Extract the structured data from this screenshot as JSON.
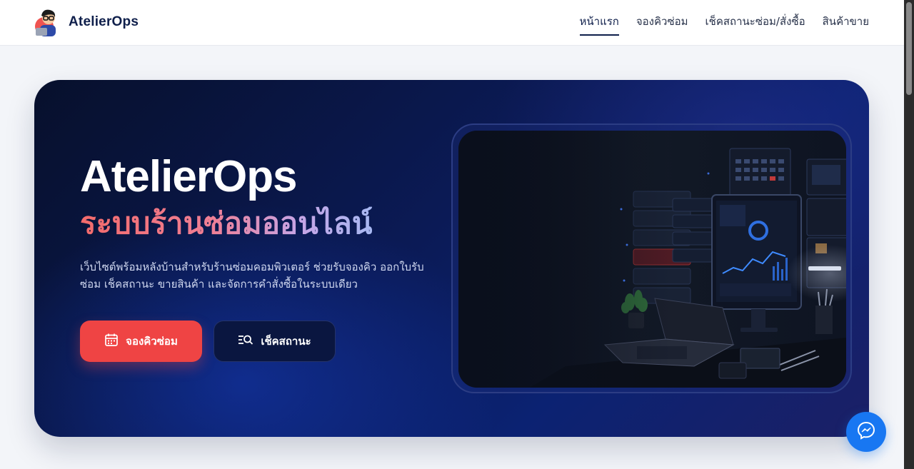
{
  "header": {
    "brand": "AtelierOps",
    "nav": [
      {
        "label": "หน้าแรก",
        "active": true
      },
      {
        "label": "จองคิวซ่อม",
        "active": false
      },
      {
        "label": "เช็คสถานะซ่อม/สั่งซื้อ",
        "active": false
      },
      {
        "label": "สินค้าขาย",
        "active": false
      }
    ]
  },
  "hero": {
    "title": "AtelierOps",
    "subtitle": "ระบบร้านซ่อมออนไลน์",
    "description": "เว็บไซต์พร้อมหลังบ้านสำหรับร้านซ่อมคอมพิวเตอร์ ช่วยรับจองคิว ออกใบรับซ่อม เช็คสถานะ ขายสินค้า และจัดการคำสั่งซื้อในระบบเดียว",
    "primary_button": "จองคิวซ่อม",
    "secondary_button": "เช็คสถานะ"
  },
  "colors": {
    "accent": "#ef4444",
    "brand": "#0f1f4b",
    "messenger": "#1877f2"
  },
  "icons": {
    "logo": "developer-avatar-icon",
    "primary_button": "calendar-icon",
    "secondary_button": "list-search-icon",
    "chat": "messenger-icon"
  }
}
